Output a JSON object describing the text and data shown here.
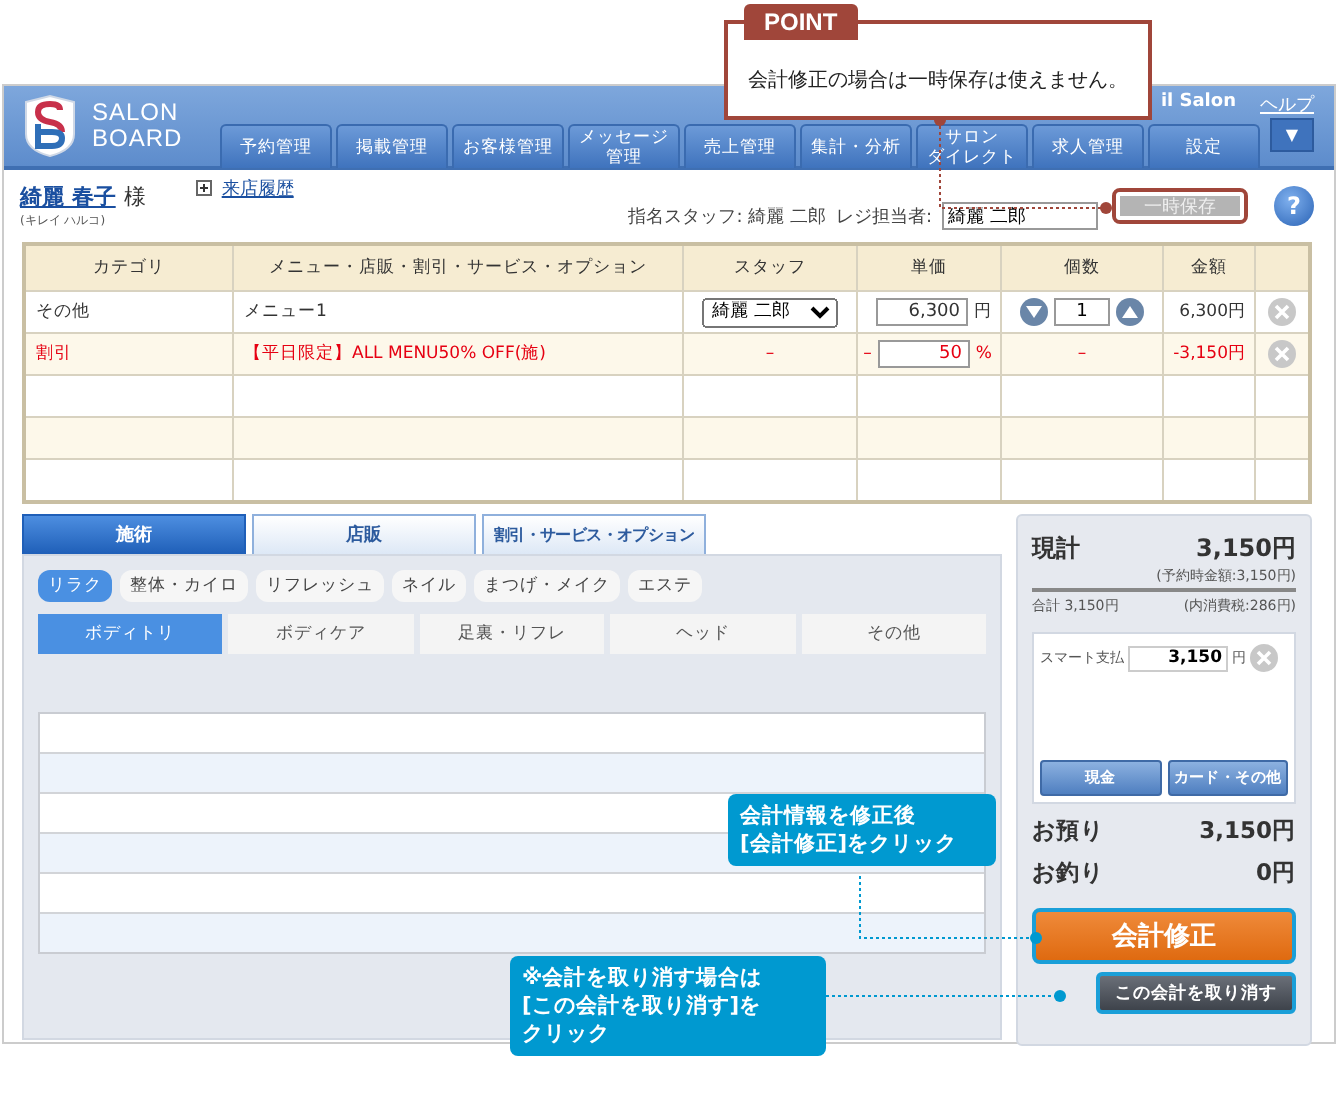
{
  "header": {
    "logo_top": "SALON",
    "logo_bottom": "BOARD",
    "salon_name": "il Salon",
    "help_link": "ヘルプ",
    "menu_button": "▼",
    "nav": [
      {
        "label": "予約管理"
      },
      {
        "label": "掲載管理"
      },
      {
        "label": "お客様管理"
      },
      {
        "lines": [
          "メッセージ",
          "管理"
        ]
      },
      {
        "label": "売上管理"
      },
      {
        "label": "集計・分析"
      },
      {
        "lines": [
          "サロン",
          "ダイレクト"
        ]
      },
      {
        "label": "求人管理"
      },
      {
        "label": "設定"
      }
    ]
  },
  "customer": {
    "name": "綺麗 春子",
    "honorific": "様",
    "reading": "(キレイ ハルコ)",
    "history_link": "来店履歴"
  },
  "staff": {
    "label": "指名スタッフ: 綺麗 二郎"
  },
  "register": {
    "label": "レジ担当者:",
    "value": "綺麗 二郎"
  },
  "hold_button": {
    "label": "一時保存",
    "disabled": true
  },
  "help_button": "?",
  "table": {
    "columns": [
      "カテゴリ",
      "メニュー・店販・割引・サービス・オプション",
      "スタッフ",
      "単価",
      "個数",
      "金額"
    ],
    "rows": [
      {
        "kind": "item",
        "category": "その他",
        "menu": "メニュー1",
        "staff": "綺麗 二郎",
        "price": "6,300",
        "unit": "円",
        "quantity": "1",
        "amount": "6,300円"
      },
      {
        "kind": "discount",
        "category": "割引",
        "menu": "【平日限定】ALL MENU50% OFF(施)",
        "staff": "–",
        "price_prefix": "–",
        "price": "50",
        "unit": "%",
        "quantity": "–",
        "amount": "-3,150円"
      },
      {
        "kind": "empty"
      },
      {
        "kind": "empty"
      },
      {
        "kind": "empty"
      }
    ]
  },
  "category_tabs": [
    {
      "label": "施術",
      "selected": true
    },
    {
      "label": "店販",
      "selected": false
    },
    {
      "label": "割引・サービス・オプション",
      "selected": false
    }
  ],
  "genres": [
    {
      "label": "リラク",
      "selected": true
    },
    {
      "label": "整体・カイロ",
      "selected": false
    },
    {
      "label": "リフレッシュ",
      "selected": false
    },
    {
      "label": "ネイル",
      "selected": false
    },
    {
      "label": "まつげ・メイク",
      "selected": false
    },
    {
      "label": "エステ",
      "selected": false
    }
  ],
  "subcategories": [
    {
      "label": "ボディトリ",
      "selected": true
    },
    {
      "label": "ボディケア",
      "selected": false
    },
    {
      "label": "足裏・リフレ",
      "selected": false
    },
    {
      "label": "ヘッド",
      "selected": false
    },
    {
      "label": "その他",
      "selected": false
    }
  ],
  "menu_list": [
    {
      "kind": "empty"
    },
    {
      "kind": "empty"
    },
    {
      "kind": "empty"
    },
    {
      "kind": "empty"
    },
    {
      "kind": "empty"
    },
    {
      "kind": "empty"
    }
  ],
  "summary": {
    "subtotal_label": "現計",
    "subtotal": "3,150円",
    "reserved_note": "(予約時金額:3,150円)",
    "total": "合計 3,150円",
    "tax": "(内消費税:286円)",
    "payment_label": "スマート支払",
    "payment_value": "3,150",
    "payment_unit": "円",
    "cash_button": "現金",
    "card_button": "カード・その他",
    "received_label": "お預り",
    "received": "3,150円",
    "change_label": "お釣り",
    "change": "0円",
    "fix_button": "会計修正",
    "cancel_button": "この会計を取り消す"
  },
  "annotations": {
    "point_badge": "POINT",
    "point_text": "会計修正の場合は一時保存は使えません。",
    "notes": [
      {
        "lines": [
          "会計情報を修正後",
          "[会計修正]をクリック"
        ]
      },
      {
        "lines": [
          "※会計を取り消す場合は",
          "[この会計を取り消す]を",
          "クリック"
        ]
      }
    ]
  }
}
